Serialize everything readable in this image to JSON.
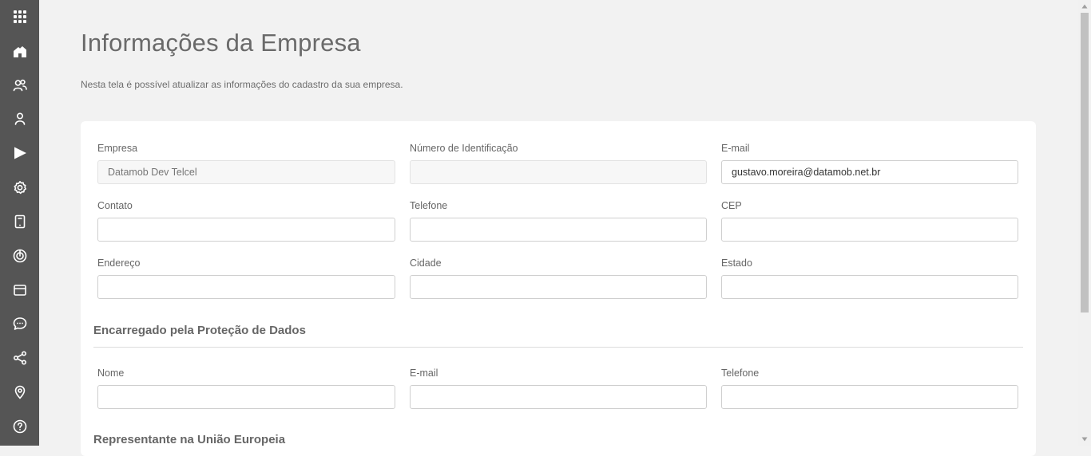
{
  "sidebar": {
    "items": [
      {
        "icon": "apps-grid-icon",
        "name": "nav-apps"
      },
      {
        "icon": "home-icon",
        "name": "nav-home"
      },
      {
        "icon": "users-icon",
        "name": "nav-users"
      },
      {
        "icon": "user-icon",
        "name": "nav-profile"
      },
      {
        "icon": "play-icon",
        "name": "nav-play"
      },
      {
        "icon": "gear-icon",
        "name": "nav-settings"
      },
      {
        "icon": "tablet-icon",
        "name": "nav-devices"
      },
      {
        "icon": "target-icon",
        "name": "nav-target"
      },
      {
        "icon": "window-icon",
        "name": "nav-window"
      },
      {
        "icon": "chat-icon",
        "name": "nav-chat"
      },
      {
        "icon": "share-icon",
        "name": "nav-share"
      },
      {
        "icon": "location-pin-icon",
        "name": "nav-location"
      },
      {
        "icon": "help-icon",
        "name": "nav-help"
      }
    ]
  },
  "page": {
    "title": "Informações da Empresa",
    "subtitle": "Nesta tela é possível atualizar as informações do cadastro da sua empresa."
  },
  "company": {
    "empresa": {
      "label": "Empresa",
      "value": "",
      "placeholder": "Datamob Dev Telcel"
    },
    "numero": {
      "label": "Número de Identificação",
      "value": ""
    },
    "email": {
      "label": "E-mail",
      "value": "gustavo.moreira@datamob.net.br"
    },
    "contato": {
      "label": "Contato",
      "value": ""
    },
    "telefone": {
      "label": "Telefone",
      "value": ""
    },
    "cep": {
      "label": "CEP",
      "value": ""
    },
    "endereco": {
      "label": "Endereço",
      "value": ""
    },
    "cidade": {
      "label": "Cidade",
      "value": ""
    },
    "estado": {
      "label": "Estado",
      "value": ""
    }
  },
  "dpo": {
    "title": "Encarregado pela Proteção de Dados",
    "nome": {
      "label": "Nome",
      "value": ""
    },
    "email": {
      "label": "E-mail",
      "value": ""
    },
    "telefone": {
      "label": "Telefone",
      "value": ""
    }
  },
  "eu_rep": {
    "title": "Representante na União Europeia"
  },
  "colors": {
    "sidebar_bg": "#555555",
    "page_bg": "#f2f2f2",
    "card_bg": "#ffffff",
    "text_muted": "#666666"
  }
}
